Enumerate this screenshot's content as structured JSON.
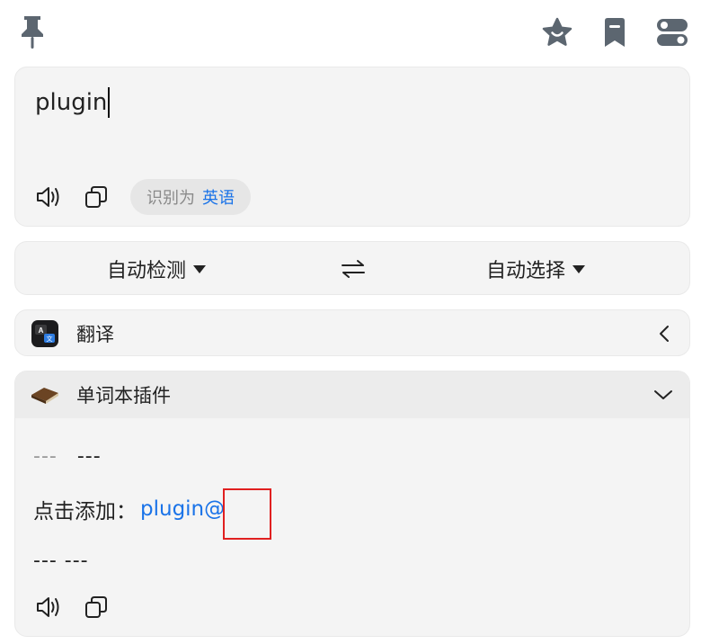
{
  "toolbar": {
    "pin_icon": "pin-icon",
    "star_icon": "star-icon",
    "bookmark_icon": "bookmark-icon",
    "settings_icon": "toggle-settings-icon"
  },
  "input": {
    "text": "plugin",
    "detected_label": "识别为",
    "detected_lang": "英语"
  },
  "languages": {
    "source": "自动检测",
    "target": "自动选择",
    "swap_icon": "swap-arrows-icon"
  },
  "service": {
    "title": "翻译",
    "collapse_icon": "chevron-left-icon"
  },
  "plugin": {
    "title": "单词本插件",
    "expand_icon": "chevron-down-icon",
    "dashes_1a": "---",
    "dashes_1b": "---",
    "add_label": "点击添加：",
    "add_word": "plugin@",
    "dashes_2": "--- ---"
  },
  "colors": {
    "accent": "#1a73e8",
    "highlight": "#e02020",
    "card_bg": "#f4f4f4"
  }
}
